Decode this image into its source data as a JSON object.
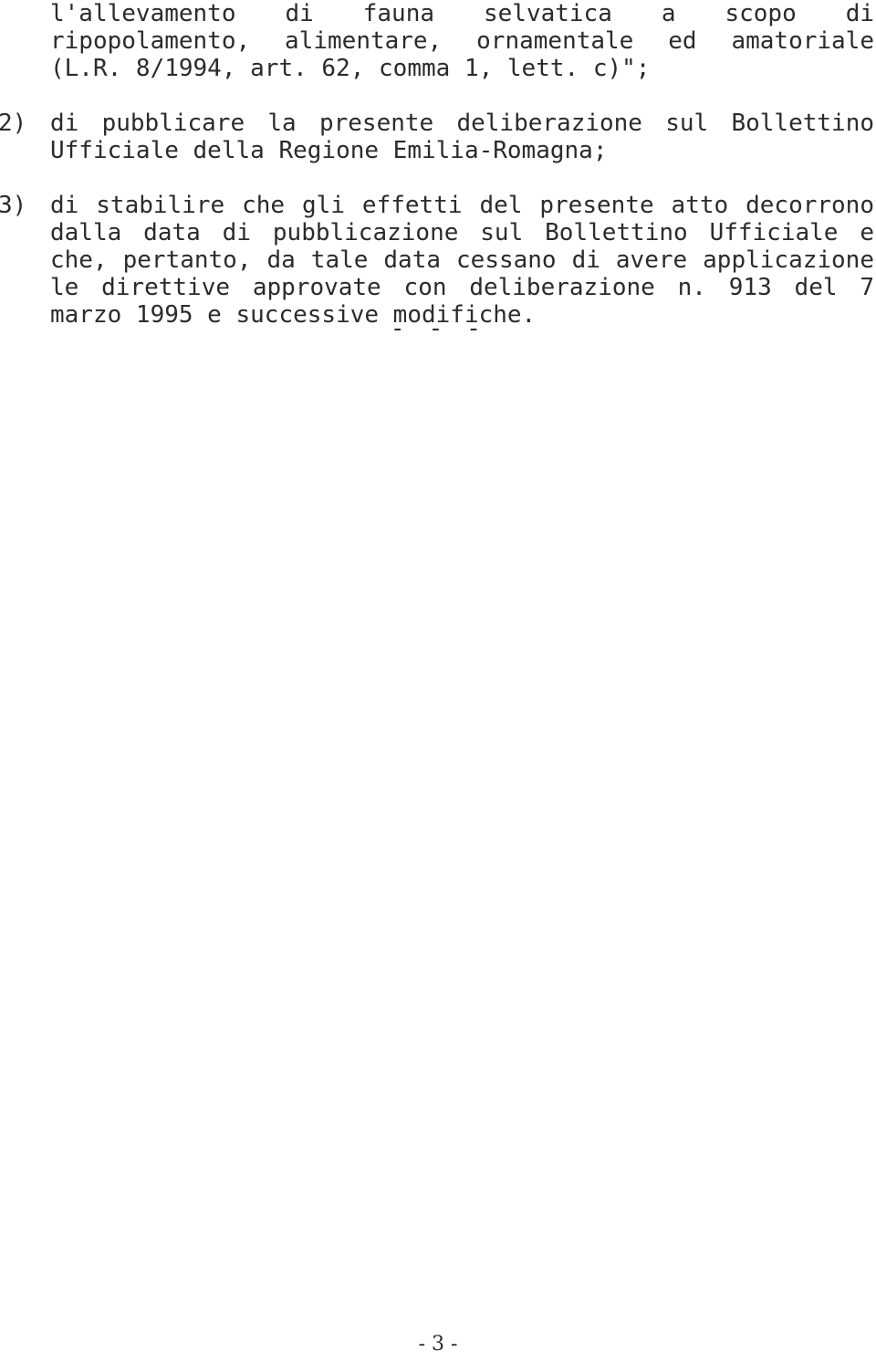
{
  "document": {
    "page_number_label": "- 3 -",
    "separator_mark": "- - -",
    "blocks": [
      {
        "kind": "continuation-paragraph",
        "marker": "",
        "lines": [
          {
            "text": "l'allevamento di fauna selvatica a scopo di",
            "justified": true
          },
          {
            "text": "ripopolamento, alimentare, ornamentale ed amatoriale",
            "justified": true
          },
          {
            "text": "(L.R. 8/1994, art. 62, comma 1, lett. c)\";",
            "justified": false
          }
        ]
      },
      {
        "kind": "numbered-item",
        "marker": "2)",
        "lines": [
          {
            "text": "di pubblicare la presente deliberazione sul Bollettino",
            "justified": true
          },
          {
            "text": "Ufficiale della Regione Emilia-Romagna;",
            "justified": false
          }
        ]
      },
      {
        "kind": "numbered-item",
        "marker": "3)",
        "lines": [
          {
            "text": "di stabilire che gli effetti del presente atto decorrono",
            "justified": true
          },
          {
            "text": "dalla data di pubblicazione sul Bollettino Ufficiale e",
            "justified": true
          },
          {
            "text": "che, pertanto, da tale data cessano di avere applicazione",
            "justified": true
          },
          {
            "text": "le direttive approvate con deliberazione n. 913 del 7",
            "justified": true
          },
          {
            "text": "marzo 1995 e successive modifiche.",
            "justified": false
          }
        ]
      }
    ]
  }
}
